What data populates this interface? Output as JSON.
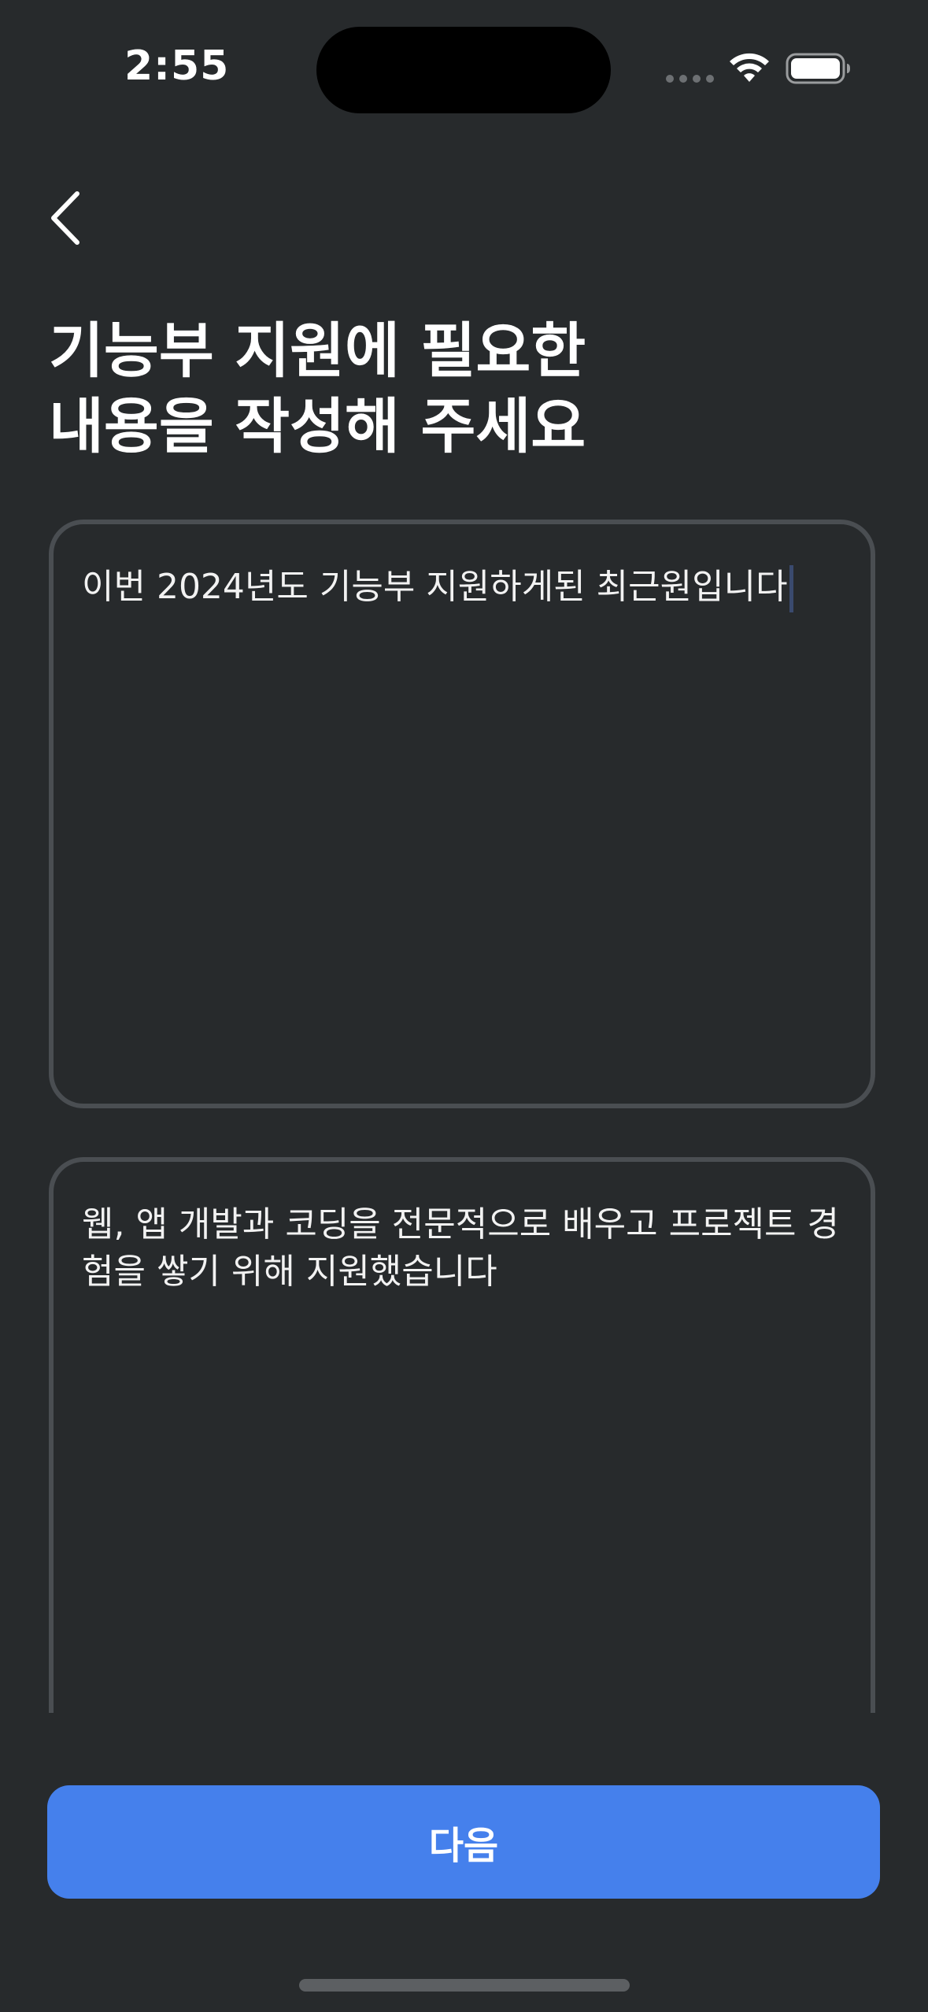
{
  "status_bar": {
    "time": "2:55",
    "wifi_icon": "wifi-icon",
    "battery_icon": "battery-icon"
  },
  "nav": {
    "back_icon": "chevron-left-icon"
  },
  "title": {
    "line1": "기능부 지원에 필요한",
    "line2": "내용을 작성해 주세요"
  },
  "fields": {
    "intro": {
      "value": "이번 2024년도 기능부 지원하게된 최근원입니다"
    },
    "motivation": {
      "value": "웹, 앱 개발과 코딩을 전문적으로 배우고 프로젝트 경험을 쌓기 위해 지원했습니다"
    }
  },
  "actions": {
    "next_label": "다음"
  },
  "colors": {
    "background": "#272a2c",
    "accent": "#4580ec",
    "border": "#4a4e52"
  }
}
